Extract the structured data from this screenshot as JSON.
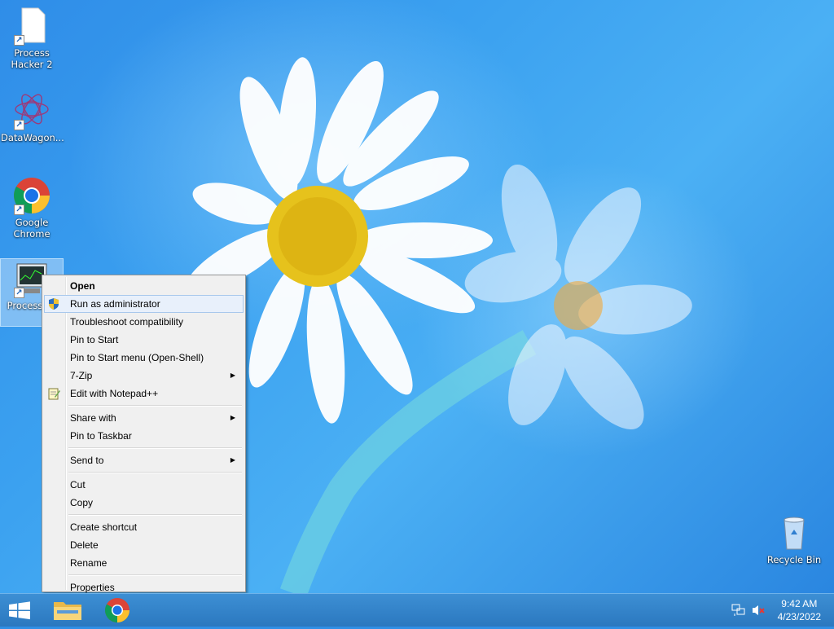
{
  "desktop": {
    "icons": [
      {
        "label": "Process Hacker 2",
        "icon": "blank-file-icon"
      },
      {
        "label": "DataWagon...",
        "icon": "datawagon-icon"
      },
      {
        "label": "Google Chrome",
        "icon": "chrome-icon"
      },
      {
        "label": "ProcessH r",
        "icon": "processhacker-icon",
        "selected": true
      }
    ],
    "recycle_bin": {
      "label": "Recycle Bin",
      "icon": "recycle-bin-icon"
    }
  },
  "context_menu": {
    "items": [
      {
        "label": "Open",
        "bold": true
      },
      {
        "label": "Run as administrator",
        "icon": "uac-shield-icon",
        "highlighted": true
      },
      {
        "label": "Troubleshoot compatibility"
      },
      {
        "label": "Pin to Start"
      },
      {
        "label": "Pin to Start menu (Open-Shell)"
      },
      {
        "label": "7-Zip",
        "submenu": true
      },
      {
        "label": "Edit with Notepad++",
        "icon": "notepadpp-icon"
      },
      {
        "label": "Share with",
        "submenu": true
      },
      {
        "label": "Pin to Taskbar"
      },
      {
        "label": "Send to",
        "submenu": true
      },
      {
        "label": "Cut"
      },
      {
        "label": "Copy"
      },
      {
        "label": "Create shortcut"
      },
      {
        "label": "Delete"
      },
      {
        "label": "Rename"
      },
      {
        "label": "Properties"
      }
    ]
  },
  "taskbar": {
    "start": "windows-logo-icon",
    "pinned": [
      "file-explorer-icon",
      "chrome-icon"
    ],
    "tray": [
      "network-icon",
      "volume-muted-icon"
    ],
    "clock": {
      "time": "9:42 AM",
      "date": "4/23/2022"
    }
  },
  "colors": {
    "taskbar": "#2b78bf",
    "menu_bg": "#f0f0f0",
    "highlight": "#e8f0fb"
  }
}
